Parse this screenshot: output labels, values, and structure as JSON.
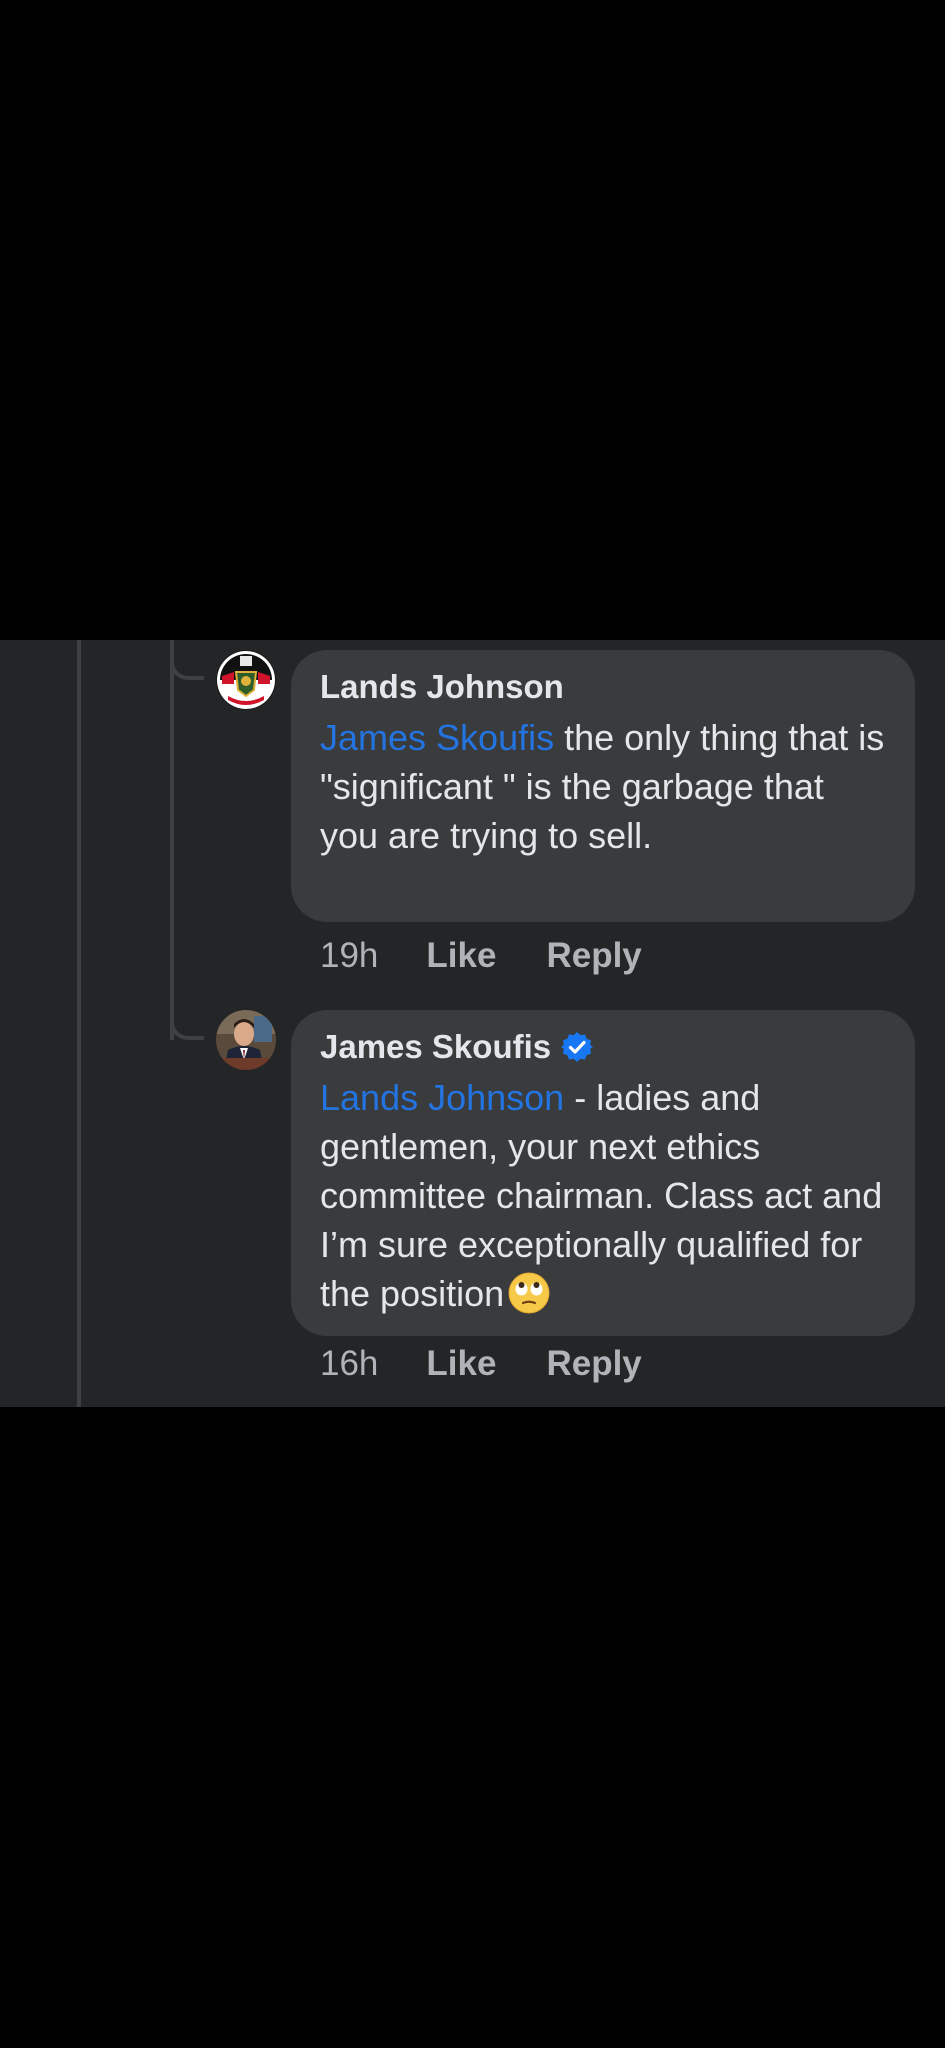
{
  "comments": [
    {
      "author": "Lands Johnson",
      "verified": false,
      "mention": "James Skoufis",
      "text": " the only thing that is \"significant \" is the garbage that you are trying to sell.",
      "time": "19h",
      "like_label": "Like",
      "reply_label": "Reply"
    },
    {
      "author": "James Skoufis",
      "verified": true,
      "mention": "Lands Johnson",
      "text": " - ladies and gentlemen, your next ethics committee chairman. Class act and I’m sure exceptionally qualified for the position",
      "emoji": "face-with-rolling-eyes",
      "time": "16h",
      "like_label": "Like",
      "reply_label": "Reply"
    }
  ],
  "colors": {
    "background": "#000000",
    "panel": "#242526",
    "bubble": "#3a3b3c",
    "text": "#e4e6eb",
    "secondary_text": "#b0b3b8",
    "mention": "#2374e1",
    "thread_line": "#3e4042",
    "verified_badge": "#1877f2"
  },
  "icons": {
    "verified": "verified-badge-icon",
    "emoji": "rolling-eyes-emoji-icon"
  }
}
